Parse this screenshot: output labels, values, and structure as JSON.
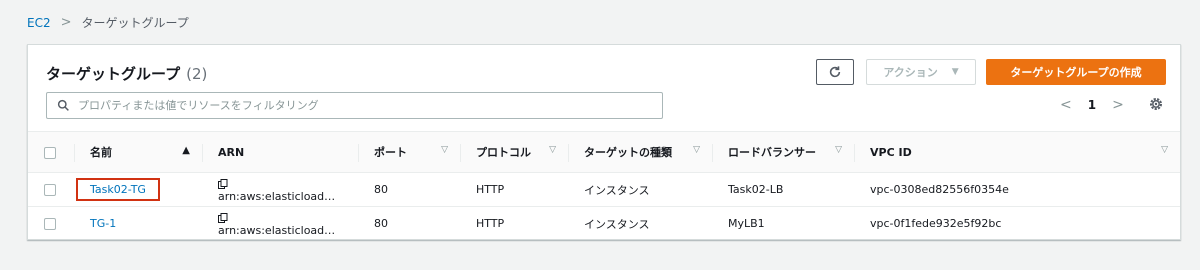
{
  "breadcrumb": {
    "root": "EC2",
    "separator": ">",
    "current": "ターゲットグループ"
  },
  "header": {
    "title": "ターゲットグループ",
    "count": "(2)",
    "action_label": "アクション",
    "create_label": "ターゲットグループの作成"
  },
  "filter": {
    "placeholder": "プロパティまたは値でリソースをフィルタリング"
  },
  "pager": {
    "prev": "<",
    "page": "1",
    "next": ">"
  },
  "table": {
    "columns": [
      "名前",
      "ARN",
      "ポート",
      "プロトコル",
      "ターゲットの種類",
      "ロードバランサー",
      "VPC ID"
    ],
    "rows": [
      {
        "name": "Task02-TG",
        "arn": "arn:aws:elasticload…",
        "port": "80",
        "protocol": "HTTP",
        "target_type": "インスタンス",
        "lb": "Task02-LB",
        "vpc": "vpc-0308ed82556f0354e"
      },
      {
        "name": "TG-1",
        "arn": "arn:aws:elasticload…",
        "port": "80",
        "protocol": "HTTP",
        "target_type": "インスタンス",
        "lb": "MyLB1",
        "vpc": "vpc-0f1fede932e5f92bc"
      }
    ]
  },
  "colors": {
    "accent": "#ec7211",
    "link": "#0073bb",
    "highlight": "#d13212"
  }
}
